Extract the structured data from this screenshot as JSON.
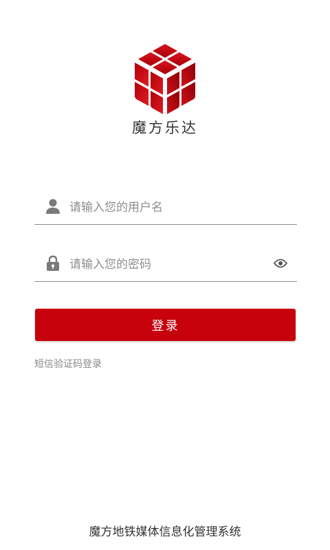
{
  "app": {
    "brand_name": "魔方乐达",
    "logo_icon": "cube-logo-icon",
    "brand_color": "#c8020c"
  },
  "login_form": {
    "username": {
      "placeholder": "请输入您的用户名",
      "value": "",
      "icon": "user-icon"
    },
    "password": {
      "placeholder": "请输入您的密码",
      "value": "",
      "icon": "lock-icon",
      "toggle_icon": "eye-icon"
    },
    "submit_label": "登录",
    "sms_login_label": "短信验证码登录"
  },
  "footer": {
    "system_name": "魔方地铁媒体信息化管理系统"
  }
}
